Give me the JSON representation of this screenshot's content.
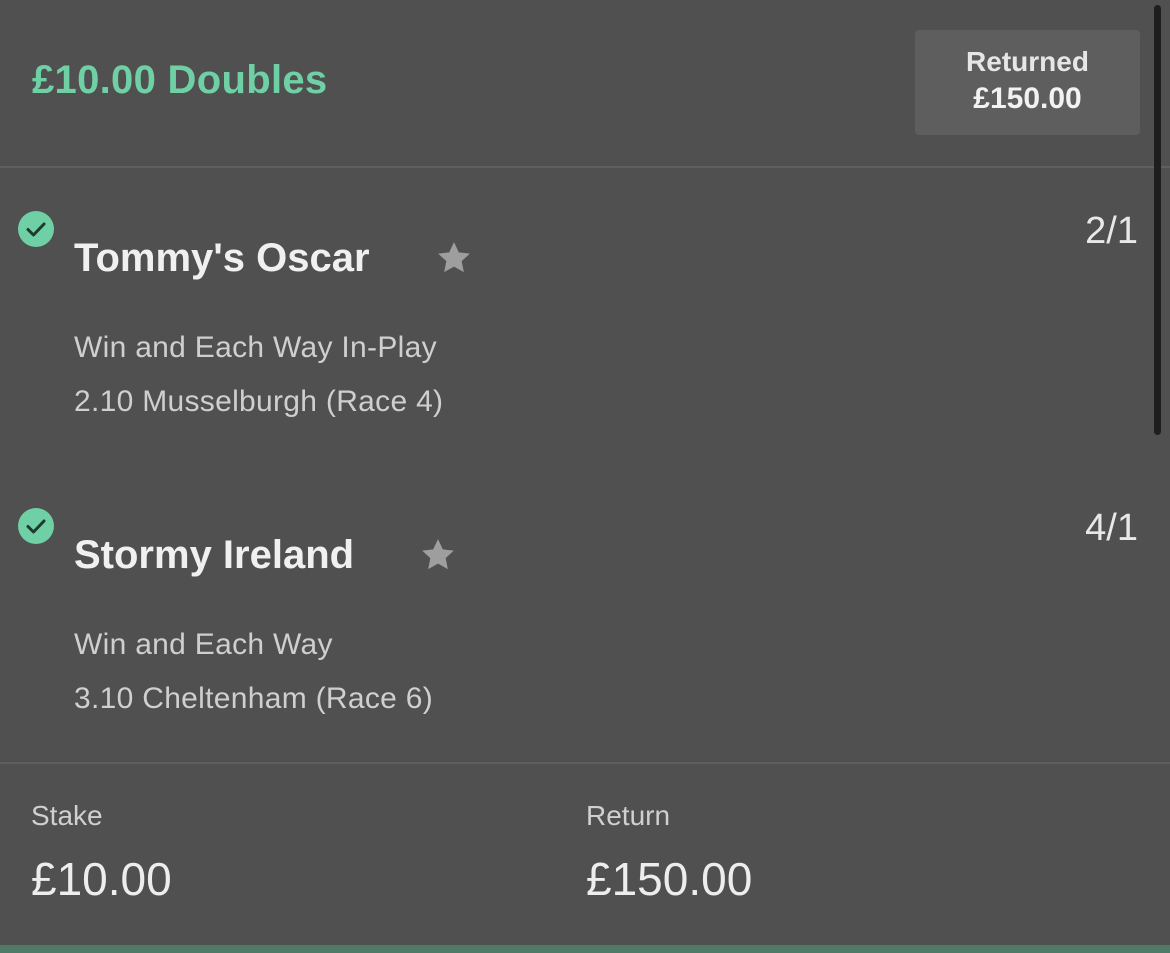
{
  "bet": {
    "title": "£10.00 Doubles",
    "status_label": "Returned",
    "status_amount": "£150.00"
  },
  "selections": [
    {
      "name": "Tommy's Oscar",
      "odds": "2/1",
      "market": "Win and Each Way In-Play",
      "event": "2.10 Musselburgh (Race 4)",
      "icon": "check-circle-icon"
    },
    {
      "name": "Stormy Ireland",
      "odds": "4/1",
      "market": "Win and Each Way",
      "event": "3.10 Cheltenham (Race 6)",
      "icon": "check-circle-icon"
    }
  ],
  "summary": {
    "stake_label": "Stake",
    "stake_value": "£10.00",
    "return_label": "Return",
    "return_value": "£150.00"
  },
  "colors": {
    "accent": "#6fd0a6",
    "background": "#505050",
    "badge": "#5e5e5e"
  }
}
